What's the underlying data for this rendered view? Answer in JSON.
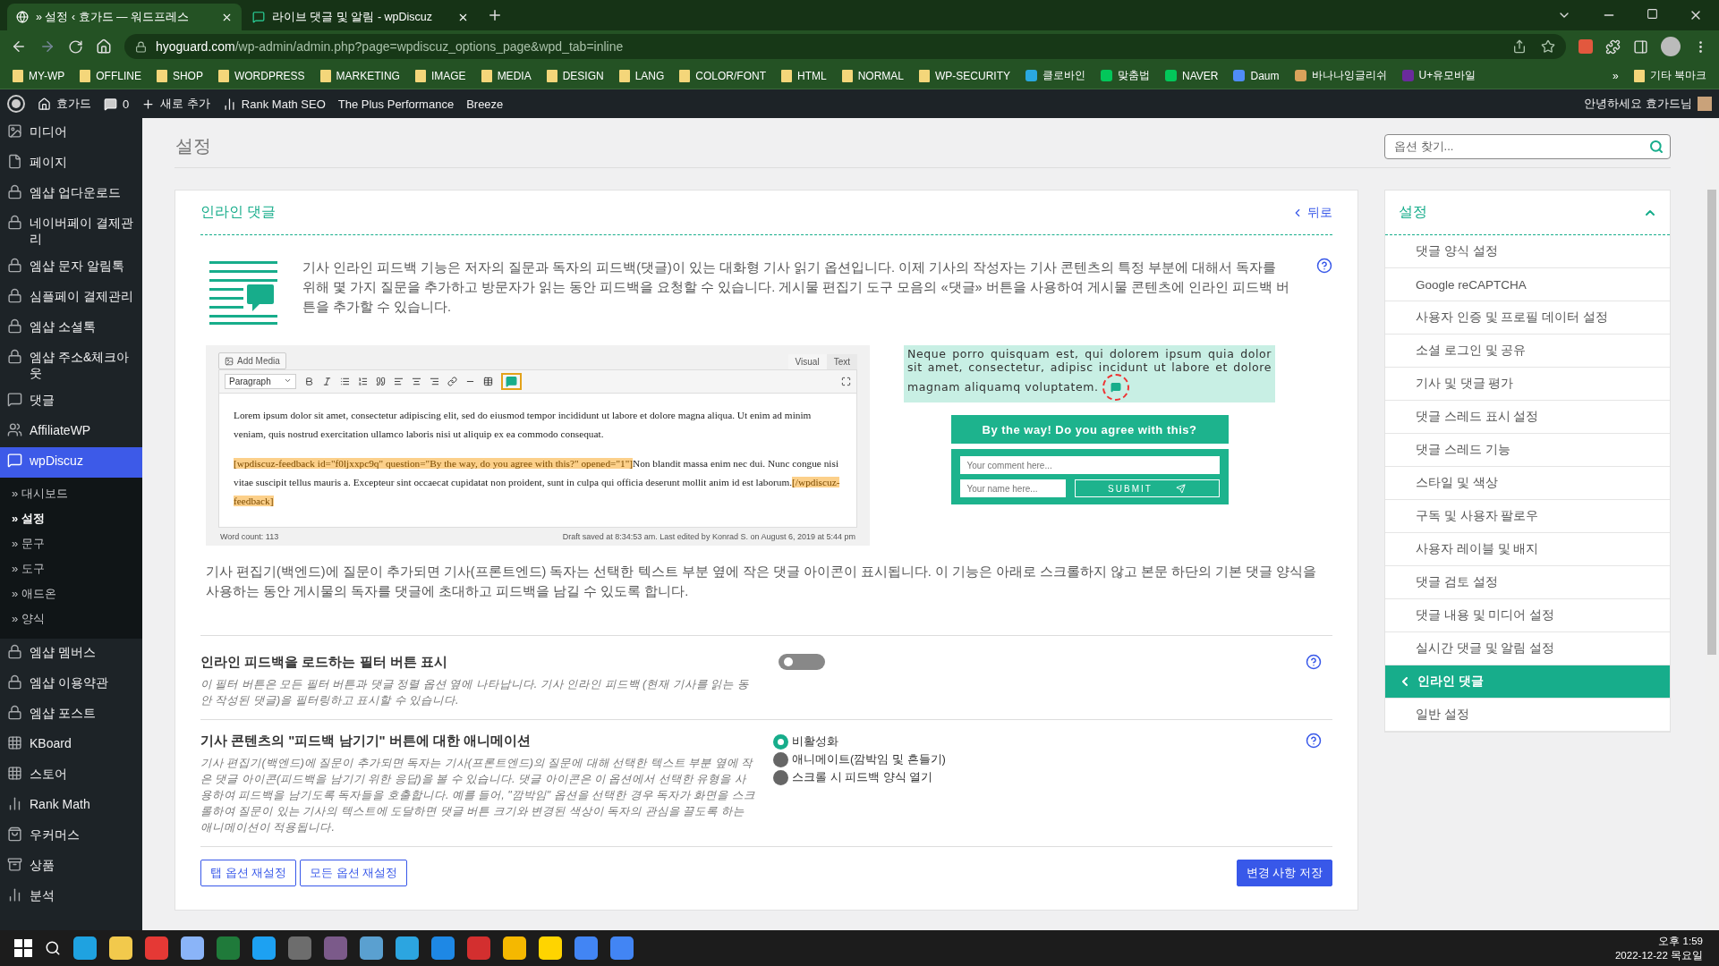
{
  "browser": {
    "tabs": [
      {
        "title": "» 설정 ‹ 효가드 — 워드프레스",
        "selected": true
      },
      {
        "title": "라이브 댓글 및 알림 - wpDiscuz",
        "selected": false
      }
    ],
    "url_host": "hyoguard.com",
    "url_path": "/wp-admin/admin.php?page=wpdiscuz_options_page&wpd_tab=inline",
    "bookmarks": [
      {
        "label": "MY-WP",
        "kind": "folder"
      },
      {
        "label": "OFFLINE",
        "kind": "folder"
      },
      {
        "label": "SHOP",
        "kind": "folder"
      },
      {
        "label": "WORDPRESS",
        "kind": "folder"
      },
      {
        "label": "MARKETING",
        "kind": "folder"
      },
      {
        "label": "IMAGE",
        "kind": "folder"
      },
      {
        "label": "MEDIA",
        "kind": "folder"
      },
      {
        "label": "DESIGN",
        "kind": "folder"
      },
      {
        "label": "LANG",
        "kind": "folder"
      },
      {
        "label": "COLOR/FONT",
        "kind": "folder"
      },
      {
        "label": "HTML",
        "kind": "folder"
      },
      {
        "label": "NORMAL",
        "kind": "folder"
      },
      {
        "label": "WP-SECURITY",
        "kind": "folder"
      },
      {
        "label": "클로바인",
        "kind": "site"
      },
      {
        "label": "맞춤법",
        "kind": "site"
      },
      {
        "label": "NAVER",
        "kind": "site"
      },
      {
        "label": "Daum",
        "kind": "site"
      },
      {
        "label": "바나나잉글리쉬",
        "kind": "site"
      },
      {
        "label": "U+유모바일",
        "kind": "site"
      }
    ],
    "overflow": "»",
    "other_bookmarks": "기타 북마크"
  },
  "admin_bar": {
    "site": "효가드",
    "comments": "0",
    "new": "새로 추가",
    "items": [
      "Rank Math SEO",
      "The Plus Performance",
      "Breeze"
    ],
    "greeting": "안녕하세요 효가드님"
  },
  "sidebar": [
    {
      "label": "미디어",
      "selected": false
    },
    {
      "label": "페이지",
      "selected": false
    },
    {
      "label": "엠샵 업다운로드",
      "selected": false
    },
    {
      "label": "네이버페이 결제관리",
      "selected": false
    },
    {
      "label": "엠샵 문자 알림톡",
      "selected": false
    },
    {
      "label": "심플페이 결제관리",
      "selected": false
    },
    {
      "label": "엠샵 소셜톡",
      "selected": false
    },
    {
      "label": "엠샵 주소&체크아웃",
      "selected": false
    },
    {
      "label": "댓글",
      "selected": false
    },
    {
      "label": "AffiliateWP",
      "selected": false
    },
    {
      "label": "wpDiscuz",
      "selected": true,
      "children": [
        {
          "label": "» 대시보드",
          "selected": false
        },
        {
          "label": "» 설정",
          "selected": true
        },
        {
          "label": "» 문구",
          "selected": false
        },
        {
          "label": "» 도구",
          "selected": false
        },
        {
          "label": "» 애드온",
          "selected": false
        },
        {
          "label": "» 양식",
          "selected": false
        }
      ]
    },
    {
      "label": "엠샵 멤버스",
      "selected": false
    },
    {
      "label": "엠샵 이용약관",
      "selected": false
    },
    {
      "label": "엠샵 포스트",
      "selected": false
    },
    {
      "label": "KBoard",
      "selected": false
    },
    {
      "label": "스토어",
      "selected": false
    },
    {
      "label": "Rank Math",
      "selected": false
    },
    {
      "label": "우커머스",
      "selected": false
    },
    {
      "label": "상품",
      "selected": false
    },
    {
      "label": "분석",
      "selected": false
    }
  ],
  "page_title": "설정",
  "search": {
    "placeholder": "옵션 찾기..."
  },
  "section": {
    "title": "인라인 댓글",
    "back": "뒤로",
    "intro": "기사 인라인 피드백 기능은 저자의 질문과 독자의 피드백(댓글)이 있는 대화형 기사 읽기 옵션입니다. 이제 기사의 작성자는 기사 콘텐츠의 특정 부분에 대해서 독자를 위해 몇 가지 질문을 추가하고 방문자가 읽는 동안 피드백을 요청할 수 있습니다. 게시물 편집기 도구 모음의 «댓글» 버튼을 사용하여 게시물 콘텐츠에 인라인 피드백 버튼을 추가할 수 있습니다.",
    "editor": {
      "add_media": "Add Media",
      "tabs": [
        "Visual",
        "Text"
      ],
      "format": "Paragraph",
      "paragraphs": [
        [
          {
            "text": "Lorem ipsum dolor sit amet, consectetur adipiscing elit, sed do eiusmod tempor incididunt ut labore et dolore magna aliqua. Ut enim ad minim veniam, quis nostrud exercitation ullamco laboris nisi ut aliquip ex ea commodo consequat.",
            "highlighted": false
          }
        ],
        [
          {
            "text": "[wpdiscuz-feedback id=\"f0ljxxpc9q\" question=\"By the way, do you agree with this?\" opened=\"1\"]",
            "highlighted": true
          },
          {
            "text": "Non blandit massa enim nec dui. Nunc congue nisi vitae suscipit tellus mauris a. Excepteur sint occaecat cupidatat non proident, sunt in culpa qui officia deserunt mollit anim id est laborum.",
            "highlighted": false
          },
          {
            "text": "[/wpdiscuz-feedback]",
            "highlighted": true
          }
        ]
      ],
      "word_count": "Word count: 113",
      "draft": "Draft saved at 8:34:53 am. Last edited by Konrad S. on August 6, 2019 at 5:44 pm"
    },
    "preview": {
      "text": "Neque porro quisquam est, qui dolorem ipsum quia dolor sit amet, consectetur, adipisc incidunt ut labore et dolore magnam aliquamq voluptatem.",
      "question": "By the way! Do you agree with this?",
      "comment_placeholder": "Your comment here...",
      "name_placeholder": "Your name here...",
      "submit": "SUBMIT"
    },
    "note": "기사 편집기(백엔드)에 질문이 추가되면 기사(프론트엔드) 독자는 선택한 텍스트 부분 옆에 작은 댓글 아이콘이 표시됩니다. 이 기능은 아래로 스크롤하지 않고 본문 하단의 기본 댓글 양식을 사용하는 동안 게시물의 독자를 댓글에 초대하고 피드백을 남길 수 있도록 합니다.",
    "options": [
      {
        "kind": "toggle",
        "title": "인라인 피드백을 로드하는 필터 버튼 표시",
        "description": "이 필터 버튼은 모든 필터 버튼과 댓글 정렬 옵션 옆에 나타납니다. 기사 인라인 피드백 (현재 기사를 읽는 동안 작성된 댓글)을 필터링하고 표시할 수 있습니다.",
        "on": false
      },
      {
        "kind": "radio",
        "title": "기사 콘텐츠의 \"피드백 남기기\" 버튼에 대한 애니메이션",
        "description": "기사 편집기(백엔드)에 질문이 추가되면 독자는 기사(프론트엔드)의 질문에 대해 선택한 텍스트 부분 옆에 작은 댓글 아이콘(피드백을 남기기 위한 응답)을 볼 수 있습니다. 댓글 아이콘은 이 옵션에서 선택한 유형을 사용하여 피드백을 남기도록 독자들을 호출합니다. 예를 들어, \"깜박임\" 옵션을 선택한 경우 독자가 화면을 스크롤하여 질문이 있는 기사의 텍스트에 도달하면 댓글 버튼 크기와 변경된 색상이 독자의 관심을 끌도록 하는 애니메이션이 적용됩니다.",
        "choices": [
          {
            "label": "비활성화",
            "selected": true
          },
          {
            "label": "애니메이트(깜박임 및 흔들기)",
            "selected": false
          },
          {
            "label": "스크롤 시 피드백 양식 열기",
            "selected": false
          }
        ]
      }
    ],
    "buttons": {
      "reset_tab": "탭 옵션 재설정",
      "reset_all": "모든 옵션 재설정",
      "save": "변경 사항 저장"
    }
  },
  "settings_nav": {
    "title": "설정",
    "expanded": true,
    "items": [
      {
        "label": "댓글 양식 설정",
        "selected": false
      },
      {
        "label": "Google reCAPTCHA",
        "selected": false
      },
      {
        "label": "사용자 인증 및 프로필 데이터 설정",
        "selected": false
      },
      {
        "label": "소셜 로그인 및 공유",
        "selected": false
      },
      {
        "label": "기사 및 댓글 평가",
        "selected": false
      },
      {
        "label": "댓글 스레드 표시 설정",
        "selected": false
      },
      {
        "label": "댓글 스레드 기능",
        "selected": false
      },
      {
        "label": "스타일 및 색상",
        "selected": false
      },
      {
        "label": "구독 및 사용자 팔로우",
        "selected": false
      },
      {
        "label": "사용자 레이블 및 배지",
        "selected": false
      },
      {
        "label": "댓글 검토 설정",
        "selected": false
      },
      {
        "label": "댓글 내용 및 미디어 설정",
        "selected": false
      },
      {
        "label": "실시간 댓글 및 알림 설정",
        "selected": false
      },
      {
        "label": "인라인 댓글",
        "selected": true
      },
      {
        "label": "일반 설정",
        "selected": false
      }
    ]
  },
  "taskbar": {
    "time": "오후 1:59",
    "date": "2022-12-22 목요일"
  }
}
